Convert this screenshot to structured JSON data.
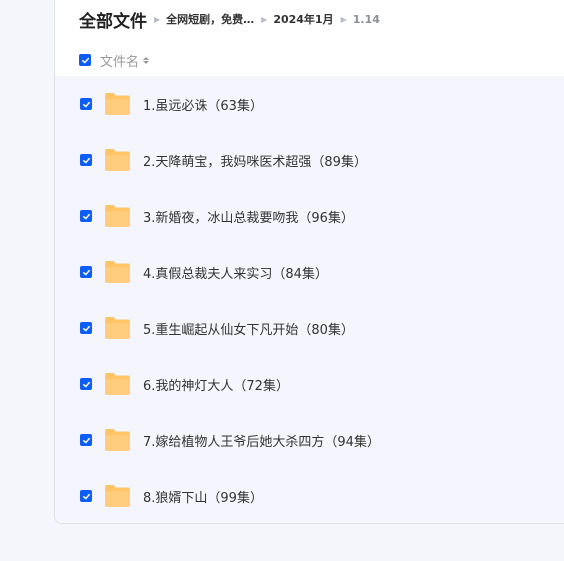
{
  "breadcrumb": {
    "root": "全部文件",
    "items": [
      "全网短剧，免费…",
      "2024年1月",
      "1.14"
    ]
  },
  "list_header": {
    "column_name": "文件名"
  },
  "files": [
    {
      "name": "1.虽远必诛（63集）",
      "icon": "folder-icon",
      "checked": true
    },
    {
      "name": "2.天降萌宝，我妈咪医术超强（89集）",
      "icon": "folder-icon",
      "checked": true
    },
    {
      "name": "3.新婚夜，冰山总裁要吻我（96集）",
      "icon": "folder-icon",
      "checked": true
    },
    {
      "name": "4.真假总裁夫人来实习（84集）",
      "icon": "folder-icon",
      "checked": true
    },
    {
      "name": "5.重生崛起从仙女下凡开始（80集）",
      "icon": "folder-icon",
      "checked": true
    },
    {
      "name": "6.我的神灯大人（72集）",
      "icon": "folder-icon",
      "checked": true
    },
    {
      "name": "7.嫁给植物人王爷后她大杀四方（94集）",
      "icon": "folder-icon",
      "checked": true
    },
    {
      "name": "8.狼婿下山（99集）",
      "icon": "folder-icon",
      "checked": true
    }
  ],
  "colors": {
    "accent": "#0d5ef5",
    "folder": "#ffc466",
    "row_background": "#f5f6fd"
  }
}
